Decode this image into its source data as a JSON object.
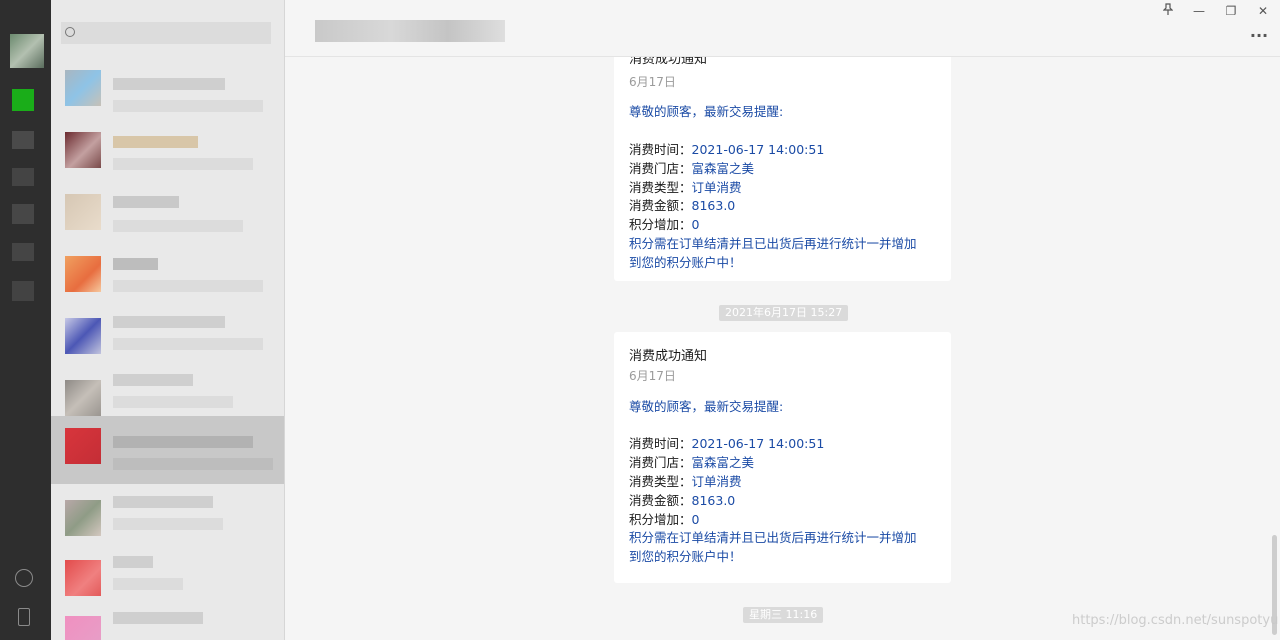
{
  "window": {
    "pin_icon": "pin-icon",
    "minimize": "—",
    "restore": "❐",
    "close": "✕"
  },
  "header": {
    "more": "···"
  },
  "messages": [
    {
      "title": "消费成功通知",
      "date": "6月17日",
      "greeting": "尊敬的顾客，最新交易提醒:",
      "fields": [
        {
          "label": "消费时间：",
          "value": "2021-06-17 14:00:51"
        },
        {
          "label": "消费门店：",
          "value": "富森富之美"
        },
        {
          "label": "消费类型：",
          "value": "订单消费"
        },
        {
          "label": "消费金额：",
          "value": "8163.0"
        },
        {
          "label": "积分增加：",
          "value": "0"
        }
      ],
      "note_line1": "积分需在订单结清并且已出货后再进行统计一并增加",
      "note_line2": "到您的积分账户中！"
    },
    {
      "title": "消费成功通知",
      "date": "6月17日",
      "greeting": "尊敬的顾客，最新交易提醒:",
      "fields": [
        {
          "label": "消费时间：",
          "value": "2021-06-17 14:00:51"
        },
        {
          "label": "消费门店：",
          "value": "富森富之美"
        },
        {
          "label": "消费类型：",
          "value": "订单消费"
        },
        {
          "label": "消费金额：",
          "value": "8163.0"
        },
        {
          "label": "积分增加：",
          "value": "0"
        }
      ],
      "note_line1": "积分需在订单结清并且已出货后再进行统计一并增加",
      "note_line2": "到您的积分账户中！"
    }
  ],
  "timestamps": [
    "2021年6月17日 15:27",
    "星期三 11:16"
  ],
  "watermark": "https://blog.csdn.net/sunspotyu",
  "colors": {
    "link_text": "#1b4ba5",
    "sidebar_bg": "#e9e9e9",
    "iconbar_bg": "#2e2e2e"
  }
}
